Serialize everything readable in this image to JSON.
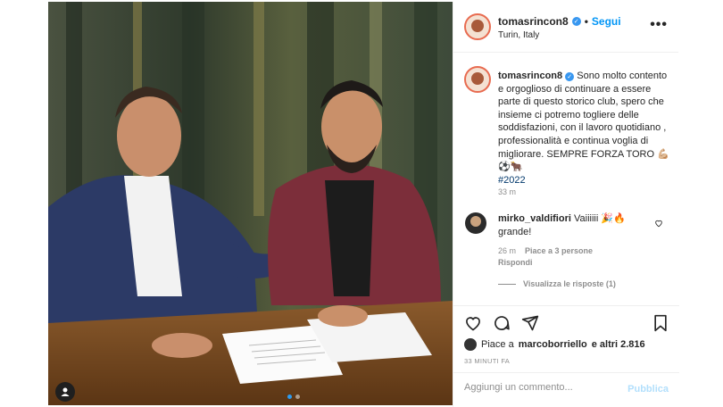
{
  "post": {
    "username": "tomasrincon8",
    "follow_label": "Segui",
    "follow_dot": "•",
    "location": "Turin, Italy",
    "more_label": "•••",
    "verified_icon": "verified-badge"
  },
  "caption": {
    "username": "tomasrincon8",
    "text": "Sono molto contento e orgoglioso di continuare a essere parte di questo storico club, spero che insieme ci potremo togliere delle soddisfazioni, con il lavoro quotidiano , professionalità e continua voglia di migliorare. SEMPRE FORZA TORO 💪🏼⚽️🐂",
    "hashtag": "#2022",
    "time": "33 m"
  },
  "comment": {
    "username": "mirko_valdifiori",
    "text": "Vaiiiiii 🎉🔥 grande!",
    "time": "26 m",
    "likes": "Piace a 3 persone",
    "reply_label": "Rispondi",
    "view_replies": "Visualizza le risposte (1)",
    "heart_icon": "heart-outline-icon"
  },
  "actions": {
    "liked_by_prefix": "Piace a",
    "liked_by_user": "marcoborriello",
    "liked_by_suffix": "e altri 2.816",
    "posted_ago": "33 MINUTI FA"
  },
  "comment_box": {
    "placeholder": "Aggiungi un commento...",
    "publish_label": "Pubblica"
  },
  "carousel": {
    "next_icon": "›",
    "slide_count": 2,
    "active_slide": 1
  },
  "colors": {
    "accent": "#0095f6",
    "verified": "#3897f0",
    "hashtag": "#00376b",
    "muted": "#8e8e8e",
    "publish_disabled": "#b2dffc"
  }
}
